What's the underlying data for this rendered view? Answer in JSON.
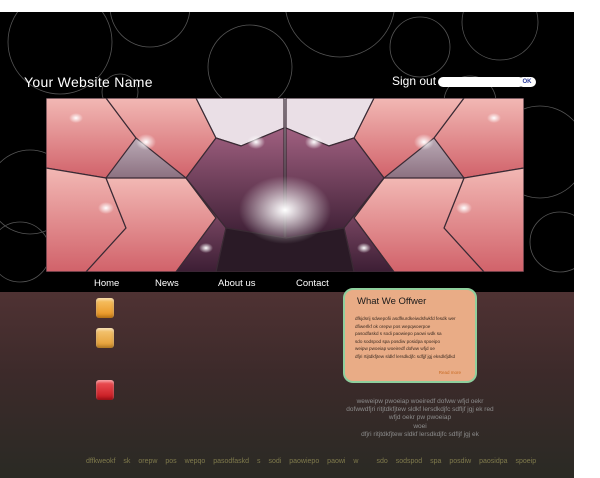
{
  "header": {
    "site_name": "Your Website Name",
    "sign_out": "Sign out",
    "search_value": "",
    "ok": "OK"
  },
  "nav": [
    "Home",
    "News",
    "About us",
    "Contact"
  ],
  "card": {
    "title": "What We Offwer",
    "lines": [
      "dfkjdsrij sdwepofii asdfkurdkeiwdsfwkfd fesdk wer",
      "dfiwerlkf ok orepw pos  wepqwoerpoe",
      "pasodfaskd s sodi paowiepo paowi wdk sa",
      "sdo sodspod spa posdiw posidpa spoeipo",
      "weipw pwoeiap woeiredf dofww wfjd oe",
      "dfjri rtijtdkfjtew sldkf lersdkdjfc sdfjjf jgj eksdkfjdkd"
    ],
    "more": "Read more"
  },
  "text_block": [
    "weweipw pwoeiap woeiredf dofww wfjd oekr",
    "dofwwdfjri ritjtdkfjtew sldkf lersdkdjfc sdfljf jgj ek red",
    "wfjd oekr pw pwoeiap",
    "woei",
    "dfjri ritjtdkfjtew sldkf lersdkdjfc sdfljf jgj ek"
  ],
  "footer": {
    "left": [
      "dffkweokf",
      "sk",
      "orepw",
      "pos",
      "wepqo",
      "pasodfaskd",
      "s",
      "sodi",
      "paowiepo",
      "paowi",
      "w"
    ],
    "right": [
      "sdo",
      "sodspod",
      "spa",
      "posdiw",
      "paosidpa",
      "spoeip"
    ]
  },
  "colors": {
    "background": "#000000",
    "lower_panel": "#3c2a2a",
    "card_bg": "#e9ac86",
    "card_border": "#8fcf9d",
    "square_orange": "#e8901c",
    "square_red": "#c4141c",
    "footer_text": "#7f7a4c"
  },
  "icons": [
    "orange-square-icon",
    "orange-square-icon",
    "red-square-icon"
  ]
}
